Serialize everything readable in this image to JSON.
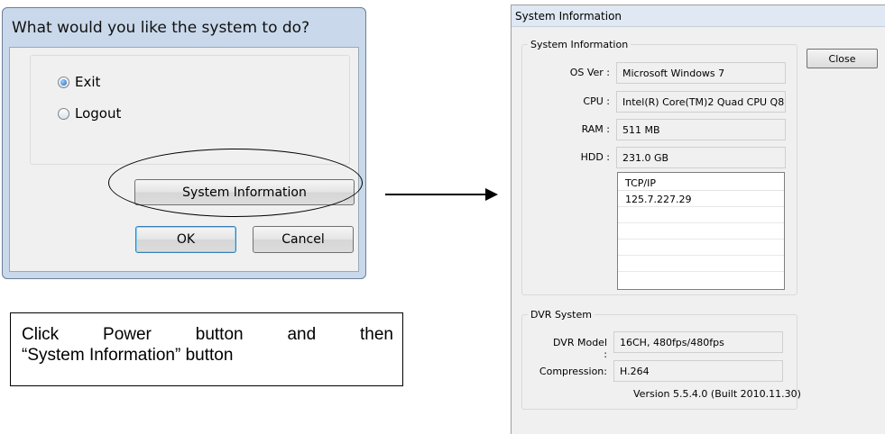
{
  "dialog": {
    "title": "What would you like the system to do?",
    "options": [
      {
        "label": "Exit",
        "selected": true
      },
      {
        "label": "Logout",
        "selected": false
      }
    ],
    "system_info_button": "System Information",
    "ok_button": "OK",
    "cancel_button": "Cancel"
  },
  "note": {
    "line1": "Click Power button and then",
    "line2": "“System Information” button"
  },
  "sysinfo_window": {
    "title": "System Information",
    "close_button": "Close",
    "system_group": {
      "label": "System Information",
      "fields": [
        {
          "label": "OS Ver :",
          "value": "Microsoft Windows 7"
        },
        {
          "label": "CPU :",
          "value": "Intel(R) Core(TM)2 Quad  CPU  Q8"
        },
        {
          "label": "RAM :",
          "value": "511 MB"
        },
        {
          "label": "HDD :",
          "value": "231.0 GB"
        }
      ],
      "ip_list": {
        "header": "TCP/IP",
        "rows": [
          "125.7.227.29",
          "",
          "",
          "",
          ""
        ]
      }
    },
    "dvr_group": {
      "label": "DVR System",
      "model_label": "DVR Model :",
      "model_value": "16CH, 480fps/480fps",
      "compression_label": "Compression:",
      "compression_value": "H.264",
      "version": "Version 5.5.4.0 (Built 2010.11.30)"
    }
  },
  "colors": {
    "dialog_frame": "#c9d8ea",
    "window_bg": "#f0f0f0",
    "title_bar": "#dfe8f3"
  }
}
